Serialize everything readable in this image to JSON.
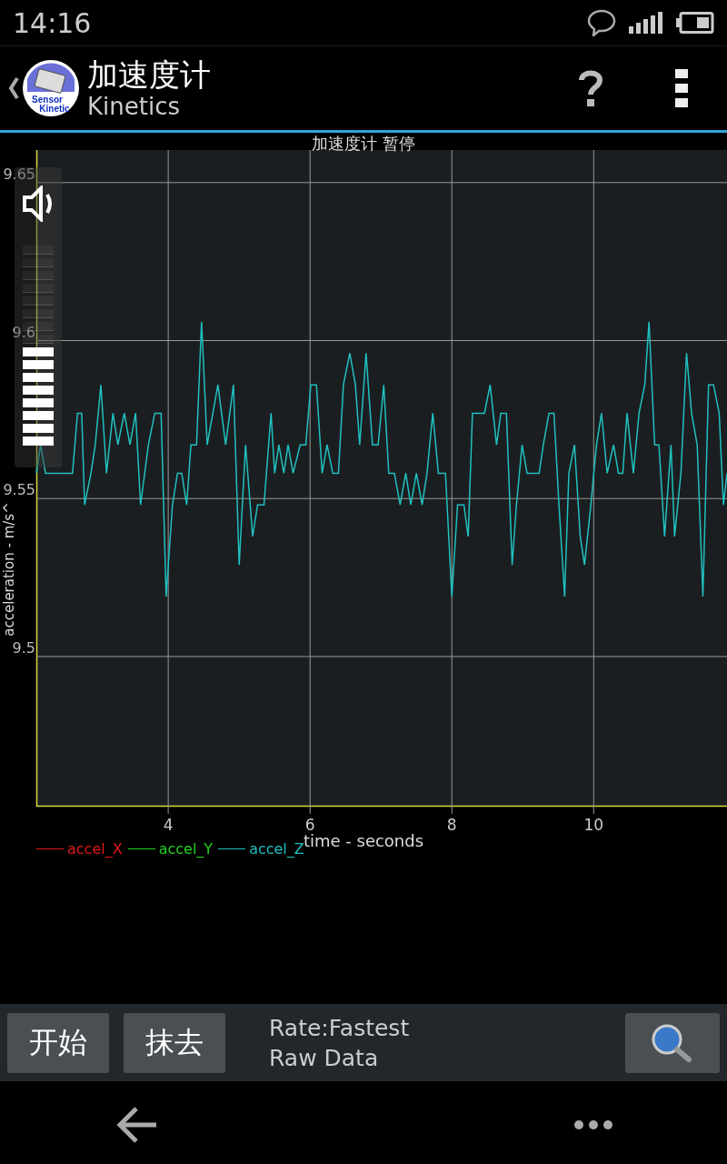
{
  "status_bar": {
    "time": "14:16"
  },
  "action_bar": {
    "logo": {
      "lines": [
        "Sensor",
        "Kinetic"
      ]
    },
    "title": "加速度计",
    "subtitle": "Kinetics"
  },
  "chart": {
    "chart_data": {
      "type": "line",
      "title": "加速度计 暂停",
      "xlabel": "time - seconds",
      "ylabel": "acceleration - m/s^",
      "xlim": [
        2.14,
        11.88
      ],
      "ylim": [
        9.4525,
        9.6603
      ],
      "xticks": [
        4,
        6,
        8,
        10
      ],
      "yticks": [
        9.5,
        9.55,
        9.6,
        9.65
      ],
      "grid": true,
      "x": [
        2.14,
        2.2,
        2.27,
        2.65,
        2.72,
        2.78,
        2.82,
        2.91,
        2.97,
        3.05,
        3.13,
        3.22,
        3.29,
        3.38,
        3.46,
        3.54,
        3.61,
        3.72,
        3.81,
        3.9,
        3.97,
        4.06,
        4.13,
        4.19,
        4.26,
        4.32,
        4.4,
        4.47,
        4.55,
        4.7,
        4.81,
        4.92,
        5.0,
        5.09,
        5.19,
        5.26,
        5.35,
        5.45,
        5.5,
        5.56,
        5.63,
        5.69,
        5.76,
        5.86,
        5.94,
        6.01,
        6.09,
        6.17,
        6.24,
        6.32,
        6.4,
        6.47,
        6.56,
        6.64,
        6.7,
        6.79,
        6.88,
        6.96,
        7.04,
        7.11,
        7.19,
        7.27,
        7.35,
        7.42,
        7.5,
        7.58,
        7.65,
        7.73,
        7.81,
        7.91,
        8.0,
        8.08,
        8.17,
        8.23,
        8.29,
        8.4,
        8.46,
        8.54,
        8.63,
        8.69,
        8.77,
        8.85,
        8.91,
        8.99,
        9.06,
        9.13,
        9.23,
        9.29,
        9.37,
        9.44,
        9.51,
        9.59,
        9.65,
        9.73,
        9.81,
        9.87,
        9.96,
        10.04,
        10.11,
        10.19,
        10.28,
        10.35,
        10.41,
        10.47,
        10.56,
        10.64,
        10.72,
        10.78,
        10.86,
        10.92,
        11.0,
        11.09,
        11.14,
        11.23,
        11.31,
        11.38,
        11.46,
        11.54,
        11.62,
        11.69,
        11.77,
        11.83,
        11.88
      ],
      "series": [
        {
          "name": "accel_Z",
          "color": "#20c0c0",
          "values": [
            9.558,
            9.567,
            9.558,
            9.558,
            9.577,
            9.577,
            9.548,
            9.558,
            9.567,
            9.586,
            9.558,
            9.577,
            9.567,
            9.577,
            9.567,
            9.577,
            9.548,
            9.567,
            9.577,
            9.577,
            9.519,
            9.548,
            9.558,
            9.558,
            9.548,
            9.567,
            9.567,
            9.606,
            9.567,
            9.586,
            9.567,
            9.586,
            9.529,
            9.567,
            9.538,
            9.548,
            9.548,
            9.577,
            9.558,
            9.567,
            9.558,
            9.567,
            9.558,
            9.567,
            9.567,
            9.586,
            9.586,
            9.558,
            9.567,
            9.558,
            9.558,
            9.586,
            9.596,
            9.586,
            9.567,
            9.596,
            9.567,
            9.567,
            9.586,
            9.558,
            9.558,
            9.548,
            9.558,
            9.548,
            9.558,
            9.548,
            9.558,
            9.577,
            9.558,
            9.558,
            9.519,
            9.548,
            9.548,
            9.538,
            9.577,
            9.577,
            9.577,
            9.586,
            9.567,
            9.577,
            9.577,
            9.529,
            9.548,
            9.567,
            9.558,
            9.558,
            9.558,
            9.567,
            9.577,
            9.577,
            9.548,
            9.519,
            9.558,
            9.567,
            9.538,
            9.529,
            9.548,
            9.567,
            9.577,
            9.558,
            9.567,
            9.558,
            9.558,
            9.577,
            9.558,
            9.577,
            9.586,
            9.606,
            9.567,
            9.567,
            9.538,
            9.567,
            9.538,
            9.558,
            9.596,
            9.577,
            9.567,
            9.519,
            9.586,
            9.586,
            9.577,
            9.548,
            9.558
          ]
        }
      ]
    },
    "legend": [
      {
        "label": "accel_X",
        "color": "#e01818"
      },
      {
        "label": "accel_Y",
        "color": "#20d020"
      }
    ]
  },
  "volume_overlay": {
    "level": 0.5
  },
  "toolbar": {
    "buttons": [
      "开始",
      "抹去"
    ],
    "info": [
      "Rate:Fastest",
      "Raw Data"
    ]
  }
}
